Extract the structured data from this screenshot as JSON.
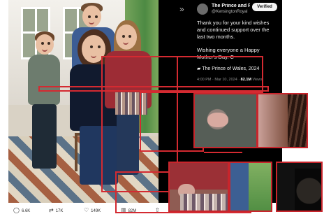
{
  "tweet": {
    "display_name": "The Prince and Prin",
    "verified_label": "Verified",
    "handle": "@KensingtonRoyal",
    "text_1": "Thank you for your kind wishes and continued support over the last two months.",
    "text_2": "Wishing everyone a Happy Mother's Day. C",
    "signature": "The Prince of Wales, 2024",
    "timestamp": "4:00 PM · Mar 10, 2024 ·",
    "views": "82.1M",
    "views_label": "Views"
  },
  "actions": {
    "replies": "6.6K",
    "reposts": "17K",
    "likes": "149K",
    "views": "82M"
  },
  "colors": {
    "highlight": "#d42a31",
    "tweet_background": "#000000"
  },
  "icons": {
    "back": "chevron-right-icon",
    "reply": "chat-bubble-icon",
    "repost": "repost-icon",
    "like": "heart-icon",
    "views": "bar-chart-icon",
    "share": "share-icon"
  }
}
